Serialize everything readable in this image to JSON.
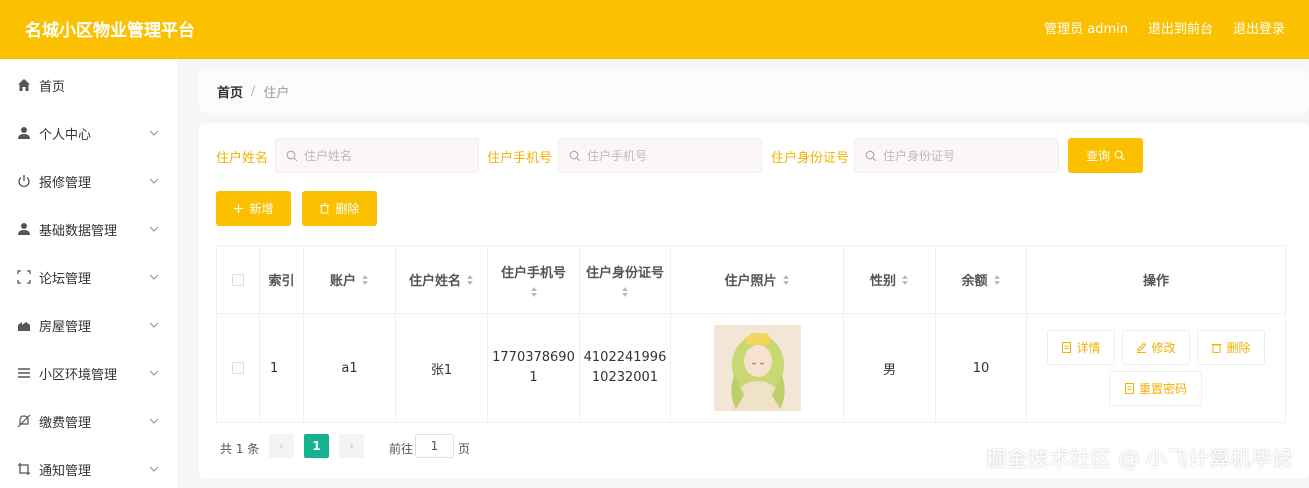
{
  "header": {
    "title": "名城小区物业管理平台",
    "admin": "管理员 admin",
    "to_front": "退出到前台",
    "logout": "退出登录"
  },
  "sidebar": {
    "items": [
      {
        "label": "首页",
        "icon": "home-icon"
      },
      {
        "label": "个人中心",
        "icon": "user-icon"
      },
      {
        "label": "报修管理",
        "icon": "power-icon"
      },
      {
        "label": "基础数据管理",
        "icon": "user-icon"
      },
      {
        "label": "论坛管理",
        "icon": "frame-icon"
      },
      {
        "label": "房屋管理",
        "icon": "house-icon"
      },
      {
        "label": "小区环境管理",
        "icon": "list-icon"
      },
      {
        "label": "缴费管理",
        "icon": "bell-off-icon"
      },
      {
        "label": "通知管理",
        "icon": "crop-icon"
      }
    ]
  },
  "breadcrumb": {
    "home": "首页",
    "sep": "/",
    "current": "住户"
  },
  "search": {
    "name_label": "住户姓名",
    "name_placeholder": "住户姓名",
    "phone_label": "住户手机号",
    "phone_placeholder": "住户手机号",
    "id_label": "住户身份证号",
    "id_placeholder": "住户身份证号",
    "query_button": "查询"
  },
  "actions": {
    "add": "新增",
    "delete": "删除"
  },
  "table": {
    "headers": [
      "索引",
      "账户",
      "住户姓名",
      "住户手机号",
      "住户身份证号",
      "住户照片",
      "性别",
      "余额",
      "操作"
    ],
    "rows": [
      {
        "index": "1",
        "account": "a1",
        "name": "张1",
        "phone_line1": "1770378690",
        "phone_line2": "1",
        "id_line1": "4102241996",
        "id_line2": "10232001",
        "gender": "男",
        "balance": "10",
        "ops": {
          "detail": "详情",
          "edit": "修改",
          "delete": "删除",
          "reset": "重置密码"
        }
      }
    ]
  },
  "pagination": {
    "total": "共 1 条",
    "current_page": "1",
    "goto_label": "前往",
    "goto_value": "1",
    "page_unit": "页",
    "prev": "‹",
    "next": "›"
  },
  "watermark": "掘金技术社区 @ 小飞计算机毕设",
  "colors": {
    "primary": "#fbc000",
    "active_page": "#13b38f"
  }
}
